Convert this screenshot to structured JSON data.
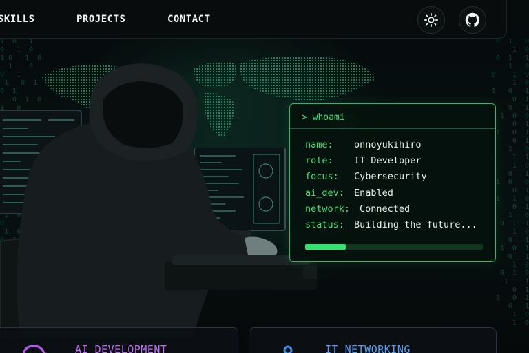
{
  "nav": {
    "links": [
      "SKILLS",
      "PROJECTS",
      "CONTACT"
    ],
    "theme_toggle_icon": "sun-icon",
    "github_icon": "github-icon"
  },
  "terminal": {
    "command": "> whoami",
    "rows": [
      {
        "key": "name:",
        "value": "onnoyukihiro"
      },
      {
        "key": "role:",
        "value": "IT Developer"
      },
      {
        "key": "focus:",
        "value": "Cybersecurity"
      },
      {
        "key": "ai_dev:",
        "value": "Enabled"
      },
      {
        "key": "network:",
        "value": "Connected"
      },
      {
        "key": "status:",
        "value": "Building the future..."
      }
    ],
    "progress": 0.23
  },
  "cards": [
    {
      "title": "AI DEVELOPMENT",
      "icon": "cloud-icon",
      "accent": "#c26cf2"
    },
    {
      "title": "IT NETWORKING",
      "icon": "network-node-icon",
      "accent": "#4f9ff7"
    }
  ],
  "colors": {
    "terminal_green": "#3ee07a",
    "background": "#05090a"
  }
}
